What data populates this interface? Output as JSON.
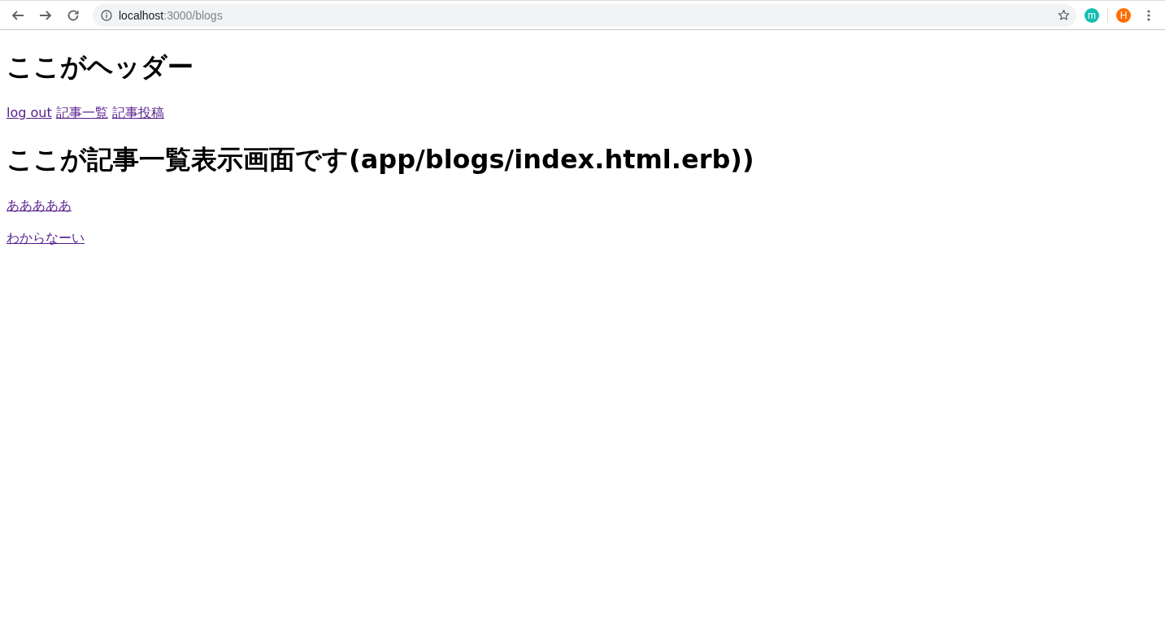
{
  "browser": {
    "url": {
      "host": "localhost",
      "path": ":3000/blogs"
    },
    "extension_badge": "m",
    "profile_avatar": "H"
  },
  "page": {
    "site_title": "ここがヘッダー",
    "nav_links": [
      {
        "label": "log out"
      },
      {
        "label": "記事一覧"
      },
      {
        "label": "記事投稿"
      }
    ],
    "heading": "ここが記事一覧表示画面です(app/blogs/index.html.erb))",
    "blog_links": [
      {
        "title": "あああああ"
      },
      {
        "title": "わからなーい"
      }
    ]
  }
}
